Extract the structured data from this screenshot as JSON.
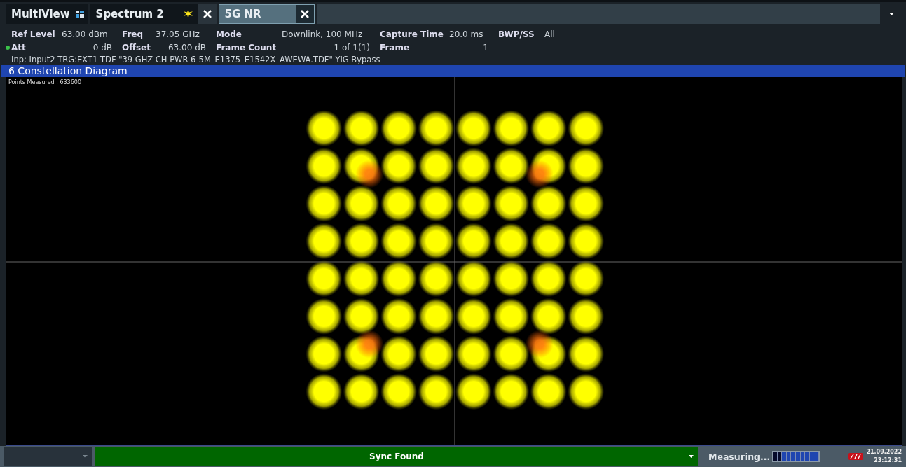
{
  "tabs": [
    {
      "label": "MultiView",
      "kind": "multiview",
      "selected": false
    },
    {
      "label": "Spectrum 2",
      "kind": "channel",
      "selected": false,
      "modified": true
    },
    {
      "label": "5G NR",
      "kind": "channel",
      "selected": true,
      "modified": false
    }
  ],
  "settings": [
    {
      "led": false,
      "cells": [
        {
          "label": "Ref Level",
          "value": "63.00 dBm"
        },
        {
          "label": "Freq",
          "value": "37.05 GHz"
        },
        {
          "label": "Mode",
          "value": "Downlink, 100 MHz"
        },
        {
          "label": "Capture Time",
          "value": "20.0 ms"
        },
        {
          "label": "BWP/SS",
          "value": "All"
        }
      ]
    },
    {
      "led": true,
      "cells": [
        {
          "label": "Att",
          "value": "0 dB"
        },
        {
          "label": "Offset",
          "value": "63.00 dB"
        },
        {
          "label": "Frame Count",
          "value": "1 of 1(1)"
        },
        {
          "label": "Frame",
          "value": "1"
        }
      ]
    }
  ],
  "input_line": "Inp: Input2 TRG:EXT1 TDF \"39 GHZ CH PWR 6-5M_E1375_E1542X_AWEWA.TDF\"  YIG Bypass",
  "diagram": {
    "title": "6 Constellation Diagram",
    "points_measured": "Points Measured : 633600"
  },
  "status_bar": {
    "message": "Sync Found",
    "message_ok": true,
    "state": "Measuring...",
    "progress": {
      "level": 0.2
    },
    "date": "21.09.2022",
    "time": "23:12:31"
  }
}
